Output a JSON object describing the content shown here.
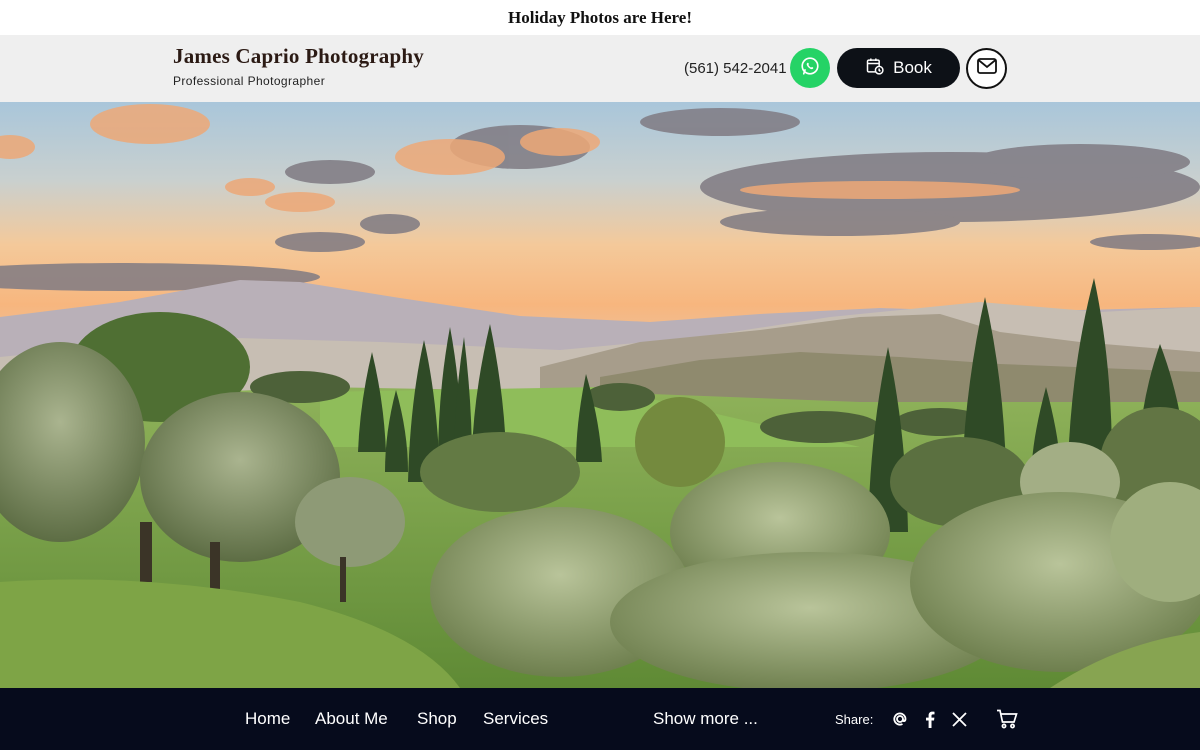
{
  "announcement": {
    "text": "Holiday Photos are Here!"
  },
  "header": {
    "brand_name": "James Caprio Photography",
    "tagline": "Professional Photographer",
    "phone": "(561) 542-2041",
    "book_label": "Book",
    "icons": {
      "whatsapp": "whatsapp-icon",
      "calendar": "calendar-icon",
      "mail": "mail-icon"
    },
    "colors": {
      "whatsapp": "#25d366",
      "book_bg": "#0d1117"
    }
  },
  "hero": {
    "subject": "Tuscan landscape at sunset with cypress trees"
  },
  "footer": {
    "nav": [
      "Home",
      "About Me",
      "Shop",
      "Services"
    ],
    "show_more": "Show more ...",
    "share_label": "Share:",
    "icons": [
      "threads-icon",
      "facebook-icon",
      "x-icon",
      "cart-icon"
    ],
    "background": "#060b1c"
  }
}
